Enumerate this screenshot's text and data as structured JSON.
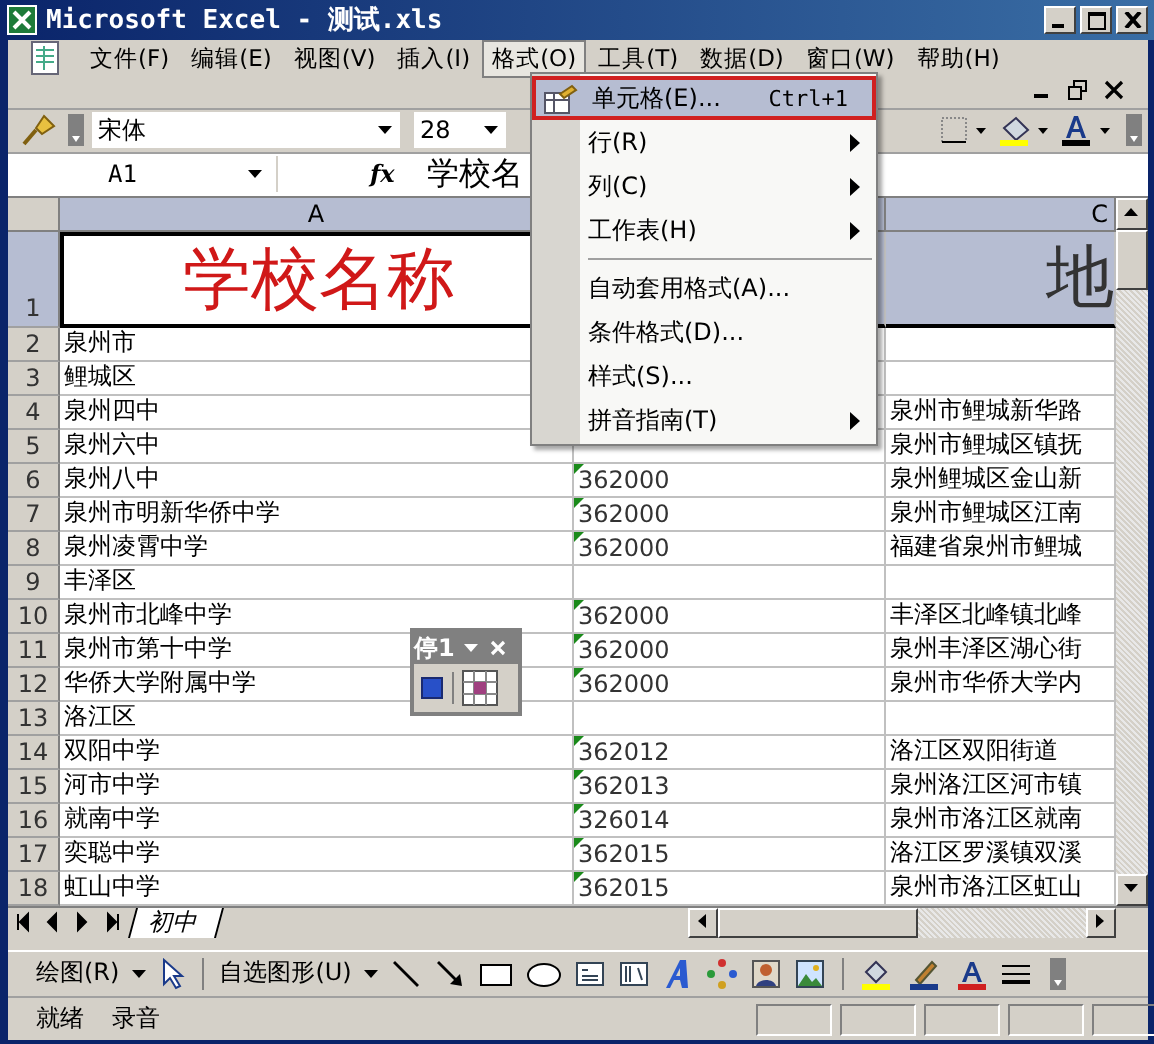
{
  "window": {
    "title": "Microsoft Excel - 测试.xls"
  },
  "menu_bar": [
    {
      "label": "文件(F)",
      "selected": false
    },
    {
      "label": "编辑(E)",
      "selected": false
    },
    {
      "label": "视图(V)",
      "selected": false
    },
    {
      "label": "插入(I)",
      "selected": false
    },
    {
      "label": "格式(O)",
      "selected": true
    },
    {
      "label": "工具(T)",
      "selected": false
    },
    {
      "label": "数据(D)",
      "selected": false
    },
    {
      "label": "窗口(W)",
      "selected": false
    },
    {
      "label": "帮助(H)",
      "selected": false
    }
  ],
  "format_toolbar": {
    "font": "宋体",
    "size": "28"
  },
  "formula_bar": {
    "name_box": "A1",
    "function_label": "fx",
    "content": "学校名"
  },
  "columns": [
    {
      "label": "A",
      "selected": true
    },
    {
      "selected": true
    },
    {
      "label": "C",
      "selected": true
    }
  ],
  "rows": [
    {
      "num": "1",
      "kind": "title",
      "selected": true,
      "text_number": false,
      "a": "学校名称",
      "c": "地"
    },
    {
      "num": "2",
      "kind": "data",
      "selected": false,
      "text_number": false,
      "a": "泉州市"
    },
    {
      "num": "3",
      "kind": "data",
      "selected": false,
      "text_number": false,
      "a": "鲤城区"
    },
    {
      "num": "4",
      "kind": "data",
      "selected": false,
      "text_number": false,
      "a": "泉州四中",
      "c": "泉州市鲤城新华路"
    },
    {
      "num": "5",
      "kind": "data",
      "selected": false,
      "text_number": false,
      "a": "泉州六中",
      "c": "泉州市鲤城区镇抚"
    },
    {
      "num": "6",
      "kind": "data",
      "selected": false,
      "text_number": true,
      "a": "泉州八中",
      "b": "362000",
      "c": "泉州鲤城区金山新"
    },
    {
      "num": "7",
      "kind": "data",
      "selected": false,
      "text_number": true,
      "a": "泉州市明新华侨中学",
      "b": "362000",
      "c": "泉州市鲤城区江南"
    },
    {
      "num": "8",
      "kind": "data",
      "selected": false,
      "text_number": true,
      "a": "泉州凌霄中学",
      "b": "362000",
      "c": "福建省泉州市鲤城"
    },
    {
      "num": "9",
      "kind": "data",
      "selected": false,
      "text_number": false,
      "a": "丰泽区"
    },
    {
      "num": "10",
      "kind": "data",
      "selected": false,
      "text_number": true,
      "a": "泉州市北峰中学",
      "b": "362000",
      "c": "丰泽区北峰镇北峰"
    },
    {
      "num": "11",
      "kind": "data",
      "selected": false,
      "text_number": true,
      "a": "泉州市第十中学",
      "b": "362000",
      "c": "泉州丰泽区湖心街"
    },
    {
      "num": "12",
      "kind": "data",
      "selected": false,
      "text_number": true,
      "a": "华侨大学附属中学",
      "b": "362000",
      "c": "泉州市华侨大学内"
    },
    {
      "num": "13",
      "kind": "data",
      "selected": false,
      "text_number": false,
      "a": "洛江区"
    },
    {
      "num": "14",
      "kind": "data",
      "selected": false,
      "text_number": true,
      "a": "双阳中学",
      "b": "362012",
      "c": "洛江区双阳街道"
    },
    {
      "num": "15",
      "kind": "data",
      "selected": false,
      "text_number": true,
      "a": "河市中学",
      "b": "362013",
      "c": "泉州洛江区河市镇"
    },
    {
      "num": "16",
      "kind": "data",
      "selected": false,
      "text_number": true,
      "a": "就南中学",
      "b": "326014",
      "c": "泉州市洛江区就南"
    },
    {
      "num": "17",
      "kind": "data",
      "selected": false,
      "text_number": true,
      "a": "奕聪中学",
      "b": "362015",
      "c": "洛江区罗溪镇双溪"
    },
    {
      "num": "18",
      "kind": "data",
      "selected": false,
      "text_number": true,
      "a": "虹山中学",
      "b": "362015",
      "c": "泉州市洛江区虹山"
    }
  ],
  "format_menu": [
    {
      "label": "单元格(E)...",
      "shortcut": "Ctrl+1",
      "selected": true,
      "submenu": false,
      "icon": true,
      "separator_before": false
    },
    {
      "label": "行(R)",
      "selected": false,
      "submenu": true,
      "icon": false,
      "separator_before": false
    },
    {
      "label": "列(C)",
      "selected": false,
      "submenu": true,
      "icon": false,
      "separator_before": false
    },
    {
      "label": "工作表(H)",
      "selected": false,
      "submenu": true,
      "icon": false,
      "separator_before": false
    },
    {
      "label": "自动套用格式(A)...",
      "selected": false,
      "submenu": false,
      "icon": false,
      "separator_before": true
    },
    {
      "label": "条件格式(D)...",
      "selected": false,
      "submenu": false,
      "icon": false,
      "separator_before": false
    },
    {
      "label": "样式(S)...",
      "selected": false,
      "submenu": false,
      "icon": false,
      "separator_before": false
    },
    {
      "label": "拼音指南(T)",
      "selected": false,
      "submenu": true,
      "icon": false,
      "separator_before": false
    }
  ],
  "floating_toolbar": {
    "title": "停1"
  },
  "sheet_tabs": [
    {
      "label": "初中",
      "selected": true
    }
  ],
  "drawing_toolbar": {
    "draw_menu": "绘图(R)",
    "autoshapes": "自选图形(U)"
  },
  "status_bar": [
    "就绪",
    "录音"
  ]
}
